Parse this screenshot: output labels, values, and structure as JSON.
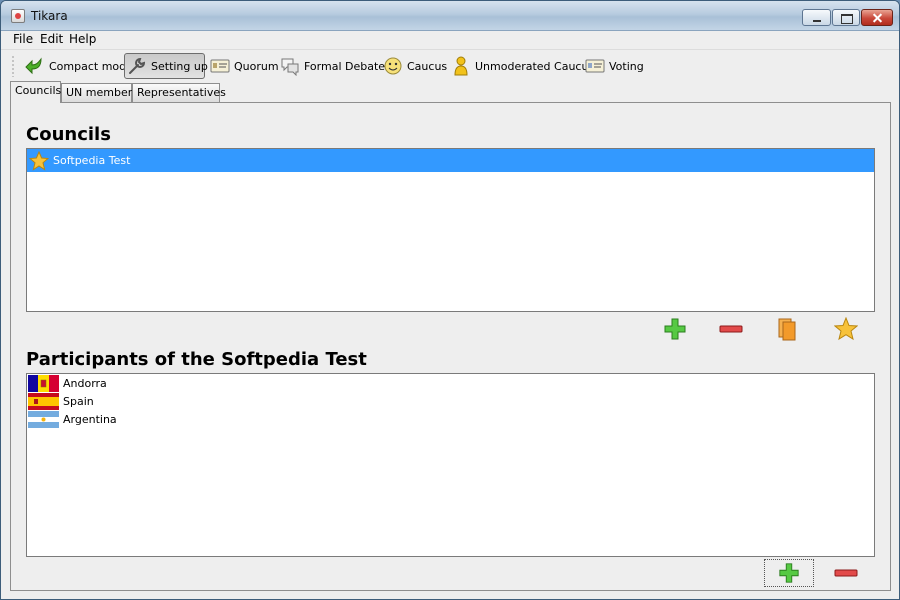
{
  "window": {
    "title": "Tikara"
  },
  "menu": {
    "items": [
      "File",
      "Edit",
      "Help"
    ]
  },
  "toolbar": {
    "buttons": [
      {
        "label": "Compact mode",
        "icon": "green-arrow-icon"
      },
      {
        "label": "Setting up",
        "icon": "wrench-icon",
        "pressed": true
      },
      {
        "label": "Quorum",
        "icon": "id-card-icon"
      },
      {
        "label": "Formal Debate",
        "icon": "speech-bubbles-icon"
      },
      {
        "label": "Caucus",
        "icon": "smiley-face-icon"
      },
      {
        "label": "Unmoderated Caucus",
        "icon": "person-icon"
      },
      {
        "label": "Voting",
        "icon": "ballot-card-icon"
      }
    ]
  },
  "tabs": [
    {
      "label": "Councils",
      "active": true
    },
    {
      "label": "UN members",
      "active": false
    },
    {
      "label": "Representatives",
      "active": false
    }
  ],
  "councils": {
    "heading": "Councils",
    "items": [
      {
        "label": "Softpedia Test",
        "selected": true,
        "icon": "star-icon"
      }
    ],
    "actions": [
      "add-icon",
      "remove-icon",
      "copy-icon",
      "star-icon"
    ]
  },
  "participants": {
    "heading": "Participants of the Softpedia Test",
    "items": [
      {
        "label": "Andorra",
        "flag": "andorra-flag-icon"
      },
      {
        "label": "Spain",
        "flag": "spain-flag-icon"
      },
      {
        "label": "Argentina",
        "flag": "argentina-flag-icon"
      }
    ],
    "actions": [
      "add-icon",
      "remove-icon"
    ]
  },
  "colors": {
    "selection": "#3399ff",
    "add_green": "#2fb52f",
    "remove_red": "#d32222",
    "star_gold": "#f4b400"
  }
}
